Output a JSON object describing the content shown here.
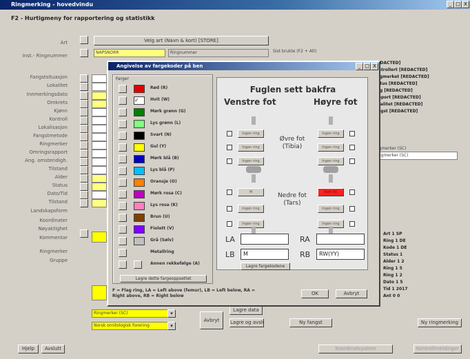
{
  "window": {
    "title": "Ringmerking - hovedvindu",
    "subtitle": "F2 - Hurtigmeny for rapportering og statistikk",
    "controls": [
      "_",
      "□",
      "X"
    ]
  },
  "form": {
    "labels": [
      "Art",
      "Inst.- Ringnummer",
      "Fangstsituasjon",
      "Lokalitet",
      "Innmerkingsdato",
      "Omkrets",
      "Kjønn",
      "Kontroll",
      "Lokalisasjon",
      "Fangstmetode",
      "Ringmerker",
      "Omringsrapport",
      "Ang. omstendigh.",
      "Tilstand",
      "Alder",
      "Status",
      "Dato/Tid",
      "Tilstand",
      "Landskapsform",
      "Koordinater",
      "Nøyaktighet",
      "Kommentar",
      "Ringmerker",
      "Gruppe"
    ],
    "art_button": "Velg art (Navn & kort) [STORE]",
    "ring_field": "NAPSNORR",
    "right_field": "Ringnummer",
    "search_label": "Sist brukte (F2 + Alt)",
    "ringmerker_select": "Ringmerker (SC)",
    "gruppe_select": "Norsk ornitologisk forening",
    "buttons": {
      "avbryt": "Avbryt",
      "lagre": "Lagre data",
      "lagre_avslutt": "Lagre og avslutt",
      "ny_fangst": "Ny fangst",
      "ny_ringmerking": "Ny ringmerking",
      "hjelp": "Hjelp",
      "avslutt": "Avslutt",
      "disabled_1": "Koordinatsystem",
      "disabled_2": "Kontrollmeldinger"
    }
  },
  "right_panel_lines": [
    "[REDACTED]",
    "Kontrollert [REDACTED]",
    "Ringmerket [REDACTED]",
    "Status [REDACTED]",
    "Ring [REDACTED]",
    "Rapport [REDACTED]",
    "Lokalitet [REDACTED]",
    "Fangst [REDACTED]"
  ],
  "bottom_panel_lines": [
    "Art 1 SP",
    "Ring 1 DE",
    "Kode 1 DE",
    "Status 1",
    "Alder 1 2",
    "Ring 1 5",
    "Ring 1 2",
    "Dato 1 5",
    "Tid 1 2017",
    "Ant 0 0"
  ],
  "dialog": {
    "title": "Angivelse av fargekoder på ben",
    "controls": [
      "_",
      "□",
      "X"
    ],
    "group_label": "Farger",
    "colors": [
      {
        "name": "Rød (R)",
        "hex": "#e00000"
      },
      {
        "name": "Hvit (W)",
        "hex": "#ffffff"
      },
      {
        "name": "Mørk grønn (G)",
        "hex": "#008000"
      },
      {
        "name": "Lys grønn (L)",
        "hex": "#80ff80"
      },
      {
        "name": "Svart (N)",
        "hex": "#000000"
      },
      {
        "name": "Gul (Y)",
        "hex": "#ffff00"
      },
      {
        "name": "Mørk blå (B)",
        "hex": "#0000c0"
      },
      {
        "name": "Lys blå (P)",
        "hex": "#00c0ff"
      },
      {
        "name": "Oransje (O)",
        "hex": "#ff8000"
      },
      {
        "name": "Mørk rosa (C)",
        "hex": "#c000c0"
      },
      {
        "name": "Lys rosa (K)",
        "hex": "#ff80c0"
      },
      {
        "name": "Brun (U)",
        "hex": "#804000"
      },
      {
        "name": "Fiolett (V)",
        "hex": "#8000ff"
      },
      {
        "name": "Grå (Sølv)",
        "hex": "#c0c0c0"
      },
      {
        "name": "Metallring",
        "hex": "#d4d0c8"
      },
      {
        "name": "Annen rekkefølge (A)",
        "hex": "#d4d0c8"
      }
    ],
    "lagre_button": "Lagre dette fargeoppsettet",
    "bird_title": "Fuglen sett bakfra",
    "left_foot": "Venstre fot",
    "right_foot": "Høyre fot",
    "upper_leg": "Øvre fot (Tibia)",
    "lower_leg": "Nedre fot (Tars)",
    "ring_button_label": "Ingen ring",
    "metal_label": "M",
    "red_label": "Rød (R)",
    "fields": {
      "la_label": "LA",
      "la_value": "",
      "ra_label": "RA",
      "ra_value": "",
      "lb_label": "LB",
      "lb_value": "M",
      "rb_label": "RB",
      "rb_value": "RW(YY)"
    },
    "legend_button": "Lagre fargekodene",
    "note": "F = Flag ring, LA = Left above (femur), LB = Left below, RA = Right above, RB = Right below",
    "ok_button": "OK",
    "cancel_button": "Avbryt"
  }
}
